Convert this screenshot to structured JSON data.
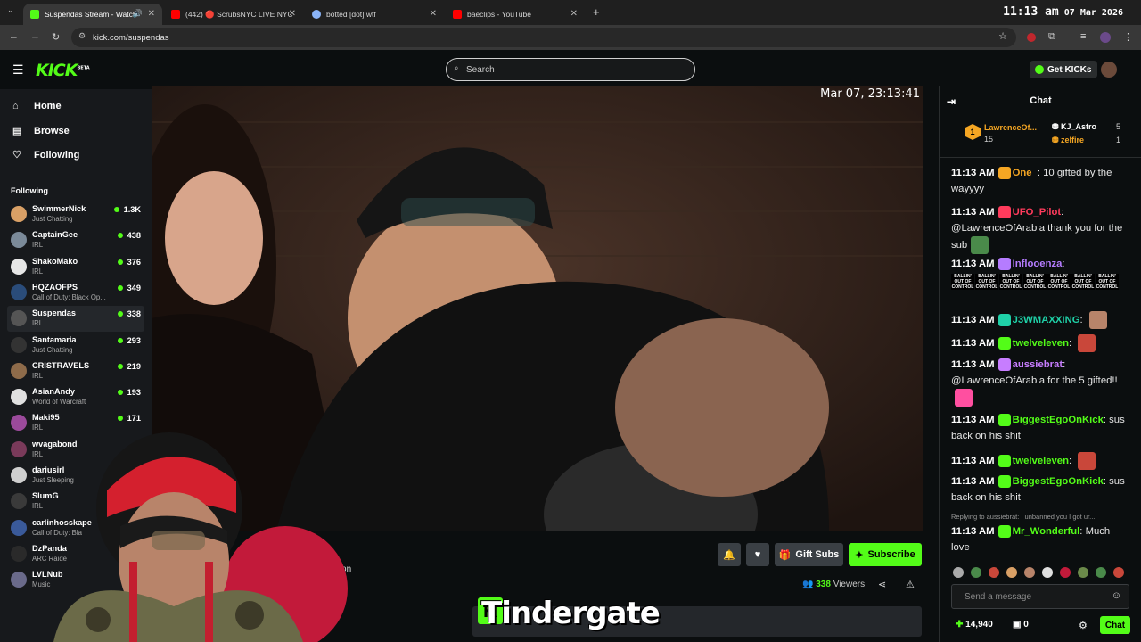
{
  "browser": {
    "tabs": [
      {
        "label": "Suspendas Stream - Watch",
        "color": "#53fc18"
      },
      {
        "label": "(442) 🔴 ScrubsNYC LIVE NYC",
        "color": "#ff0000"
      },
      {
        "label": "botted [dot] wtf",
        "color": "#8ab4f8"
      },
      {
        "label": "baeclips - YouTube",
        "color": "#ff0000"
      }
    ],
    "clock_time": "11:13 am",
    "clock_date": "07 Mar 2026",
    "url": "kick.com/suspendas"
  },
  "header": {
    "logo": "KICK",
    "logo_badge": "BETA",
    "search_placeholder": "Search",
    "get_kicks": "Get KICKs"
  },
  "sidebar": {
    "nav": [
      {
        "label": "Home",
        "icon": "home-icon"
      },
      {
        "label": "Browse",
        "icon": "browse-icon"
      },
      {
        "label": "Following",
        "icon": "heart-icon"
      }
    ],
    "following_title": "Following",
    "following": [
      {
        "name": "SwimmerNick",
        "category": "Just Chatting",
        "viewers": "1.3K",
        "color": "#d9a066"
      },
      {
        "name": "CaptainGee",
        "category": "IRL",
        "viewers": "438",
        "color": "#7b8a99"
      },
      {
        "name": "ShakoMako",
        "category": "IRL",
        "viewers": "376",
        "color": "#e6e6e6"
      },
      {
        "name": "HQZAOFPS",
        "category": "Call of Duty: Black Op...",
        "viewers": "349",
        "color": "#2a4c7a"
      },
      {
        "name": "Suspendas",
        "category": "IRL",
        "viewers": "338",
        "color": "#555555"
      },
      {
        "name": "Santamaria",
        "category": "Just Chatting",
        "viewers": "293",
        "color": "#333333"
      },
      {
        "name": "CRISTRAVELS",
        "category": "IRL",
        "viewers": "219",
        "color": "#8e6b4a"
      },
      {
        "name": "AsianAndy",
        "category": "World of Warcraft",
        "viewers": "193",
        "color": "#e0e0e0"
      },
      {
        "name": "Maki95",
        "category": "IRL",
        "viewers": "171",
        "color": "#9b4a9b"
      },
      {
        "name": "wvagabond",
        "category": "IRL",
        "viewers": "",
        "color": "#7a3a5a"
      },
      {
        "name": "dariusirl",
        "category": "Just Sleeping",
        "viewers": "",
        "color": "#cfcfcf"
      },
      {
        "name": "SlumG",
        "category": "IRL",
        "viewers": "",
        "color": "#3a3a3a"
      },
      {
        "name": "carlinhosskape",
        "category": "Call of Duty: Bla",
        "viewers": "",
        "color": "#3a5a9a"
      },
      {
        "name": "DzPanda",
        "category": "ARC Raide",
        "viewers": "",
        "color": "#2a2a2a"
      },
      {
        "name": "LVLNub",
        "category": "Music",
        "viewers": "",
        "color": "#6a6a8a"
      }
    ]
  },
  "stream": {
    "timestamp": "Mar 07, 23:13:41",
    "gift_subs": "Gift Subs",
    "subscribe": "Subscribe",
    "viewers": "338",
    "viewers_label": "Viewers",
    "caption": "Tindergate",
    "streamer_label": "Saigon"
  },
  "chat": {
    "title": "Chat",
    "leaderboard": [
      {
        "rank": "1",
        "name": "LawrenceOf...",
        "count": "15"
      },
      {
        "name": "KJ_Astro",
        "count": "5"
      },
      {
        "name": "zelfire",
        "count": "1"
      }
    ],
    "messages": [
      {
        "time": "11:13 AM",
        "user": "One_",
        "color": "#f5a623",
        "text": "10 gifted by the wayyyy"
      },
      {
        "time": "11:13 AM",
        "user": "UFO_Pilot",
        "color": "#ff3b5c",
        "text": "@LawrenceOfArabia thank you for the sub"
      },
      {
        "time": "11:13 AM",
        "user": "Infloоenza",
        "color": "#b57cff",
        "text": ""
      },
      {
        "time": "11:13 AM",
        "user": "J3WMAXXING",
        "color": "#1fd1a8",
        "text": ""
      },
      {
        "time": "11:13 AM",
        "user": "twelveleven",
        "color": "#53fc18",
        "text": ""
      },
      {
        "time": "11:13 AM",
        "user": "aussiebrat",
        "color": "#c77dff",
        "text": "@LawrenceOfArabia for the 5 gifted!!"
      },
      {
        "time": "11:13 AM",
        "user": "BiggestEgoOnKick",
        "color": "#53fc18",
        "text": "sus back on his shit"
      },
      {
        "time": "11:13 AM",
        "user": "twelveleven",
        "color": "#53fc18",
        "text": ""
      },
      {
        "time": "11:13 AM",
        "user": "BiggestEgoOnKick",
        "color": "#53fc18",
        "text": "sus back on his shit"
      },
      {
        "time": "11:13 AM",
        "user": "Mr_Wonderful",
        "color": "#53fc18",
        "text": "Much love"
      }
    ],
    "ballin_text": "BALLIN' OUT OF CONTROL",
    "reply_hint": "Replying to aussiebrat: I unbanned you I got ur...",
    "input_placeholder": "Send a message",
    "points": "14,940",
    "zero": "0",
    "chat_button": "Chat"
  }
}
